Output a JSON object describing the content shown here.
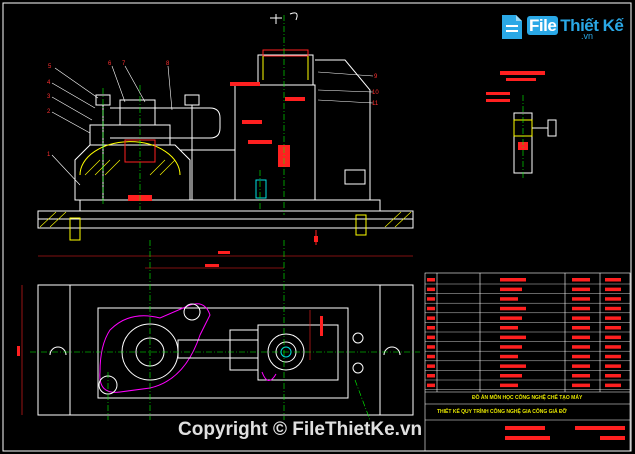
{
  "logo": {
    "brand_part1": "File",
    "brand_part2": "Thiết Kế",
    "brand_suffix": ".vn"
  },
  "watermark": {
    "text": "Copyright © FileThietKe.vn"
  },
  "title_block": {
    "project_line": "ĐỒ ÁN MÔN HỌC CÔNG NGHỆ CHẾ TẠO MÁY",
    "design_line": "THIẾT KẾ QUY TRÌNH CÔNG NGHỆ GIA CÔNG GIÁ ĐỠ"
  },
  "part_callouts": [
    "5",
    "4",
    "3",
    "2",
    "1",
    "6",
    "7",
    "8",
    "9",
    "10",
    "11"
  ],
  "colors": {
    "background": "#000000",
    "outline": "#ffffff",
    "dimension": "#ff2020",
    "centerline": "#00ff00",
    "hatch": "#ffff00",
    "accent_blue": "#2aa8e6",
    "magenta": "#ff00ff",
    "cyan": "#00e0e0"
  }
}
